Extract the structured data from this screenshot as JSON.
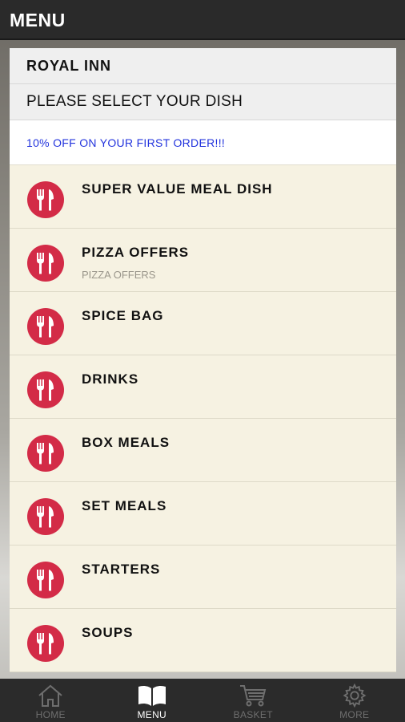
{
  "topbar": {
    "title": "MENU"
  },
  "header": {
    "restaurant": "ROYAL INN",
    "select_prompt": "PLEASE SELECT YOUR DISH",
    "offer": "10% OFF ON YOUR FIRST ORDER!!!"
  },
  "categories": [
    {
      "label": "SUPER VALUE MEAL DISH",
      "sub": ""
    },
    {
      "label": "PIZZA OFFERS",
      "sub": "PIZZA OFFERS"
    },
    {
      "label": "SPICE BAG",
      "sub": ""
    },
    {
      "label": "DRINKS",
      "sub": ""
    },
    {
      "label": "BOX MEALS",
      "sub": ""
    },
    {
      "label": "SET MEALS",
      "sub": ""
    },
    {
      "label": "STARTERS",
      "sub": ""
    },
    {
      "label": "SOUPS",
      "sub": ""
    }
  ],
  "category_icon": "fork-knife-icon",
  "tabs": [
    {
      "label": "HOME",
      "icon": "home-icon",
      "active": false
    },
    {
      "label": "MENU",
      "icon": "book-icon",
      "active": true
    },
    {
      "label": "BASKET",
      "icon": "cart-icon",
      "active": false
    },
    {
      "label": "MORE",
      "icon": "gear-icon",
      "active": false
    }
  ],
  "colors": {
    "accent_red": "#d32b47",
    "offer_blue": "#2233dd",
    "item_bg": "#f6f2e2",
    "bar_dark": "#2a2a2a"
  }
}
